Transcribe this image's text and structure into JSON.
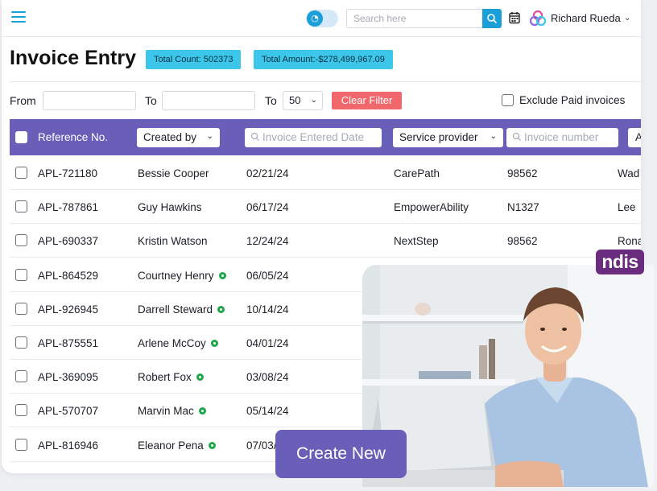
{
  "header": {
    "search_placeholder": "Search here",
    "user_name": "Richard Rueda",
    "icons": [
      "menu-icon",
      "theme-toggle-icon",
      "search-icon",
      "calendar-icon",
      "brand-logo-icon",
      "chevron-down-icon"
    ]
  },
  "page": {
    "title": "Invoice Entry",
    "total_count": "Total Count: 502373",
    "total_amount": "Total Amount:-$278,499,967.09"
  },
  "filters": {
    "from_label": "From",
    "to_label": "To",
    "to2_label": "To",
    "page_size": "50",
    "clear_label": "Clear Filter",
    "exclude_label": "Exclude Paid invoices"
  },
  "table": {
    "columns": {
      "reference": "Reference  No.",
      "created_by": "Created by",
      "date_placeholder": "Invoice Entered Date",
      "provider": "Service provider",
      "invoice_placeholder": "Invoice number",
      "last": "A"
    },
    "rows": [
      {
        "ref": "APL-721180",
        "created_by": "Bessie Cooper",
        "eye": false,
        "date": "02/21/24",
        "provider": "CarePath",
        "invoice": "98562",
        "last": "Wad"
      },
      {
        "ref": "APL-787861",
        "created_by": "Guy Hawkins",
        "eye": false,
        "date": "06/17/24",
        "provider": "EmpowerAbility",
        "invoice": "N1327",
        "last": "Lee"
      },
      {
        "ref": "APL-690337",
        "created_by": "Kristin Watson",
        "eye": false,
        "date": "12/24/24",
        "provider": "NextStep",
        "invoice": "98562",
        "last": "Rona"
      },
      {
        "ref": "APL-864529",
        "created_by": "Courtney Henry",
        "eye": true,
        "date": "06/05/24",
        "provider": "",
        "invoice": "",
        "last": ""
      },
      {
        "ref": "APL-926945",
        "created_by": "Darrell Steward",
        "eye": true,
        "date": "10/14/24",
        "provider": "",
        "invoice": "",
        "last": ""
      },
      {
        "ref": "APL-875551",
        "created_by": "Arlene McCoy",
        "eye": true,
        "date": "04/01/24",
        "provider": "",
        "invoice": "",
        "last": ""
      },
      {
        "ref": "APL-369095",
        "created_by": "Robert Fox",
        "eye": true,
        "date": "03/08/24",
        "provider": "",
        "invoice": "",
        "last": ""
      },
      {
        "ref": "APL-570707",
        "created_by": "Marvin Mac",
        "eye": true,
        "date": "05/14/24",
        "provider": "",
        "invoice": "",
        "last": ""
      },
      {
        "ref": "APL-816946",
        "created_by": "Eleanor Pena",
        "eye": true,
        "date": "07/03/",
        "provider": "",
        "invoice": "",
        "last": ""
      }
    ]
  },
  "overlay": {
    "ndis_logo": "ndis",
    "create_label": "Create New"
  },
  "colors": {
    "accent": "#1a9fd8",
    "header_purple": "#6a5fb8",
    "badge_cyan": "#3cc7ea",
    "clear_red": "#f0686c",
    "eye_green": "#1ea64a",
    "ndis_purple": "#6a2c7e"
  }
}
